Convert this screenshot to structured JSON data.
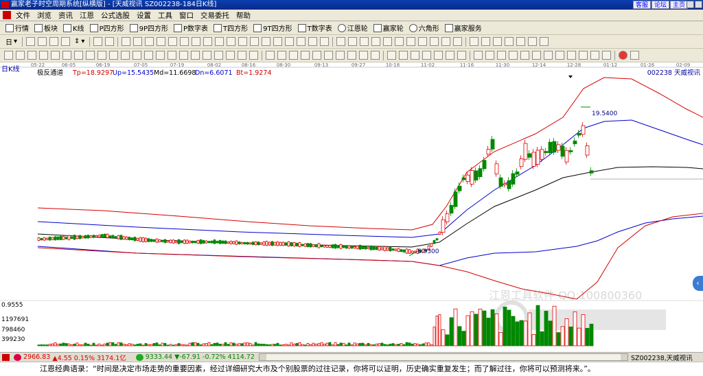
{
  "window": {
    "title": "赢家老子时空周期系统[纵横版] - [天威视讯  SZ002238-184日K线]",
    "links": [
      "客服",
      "论坛",
      "主页"
    ]
  },
  "menu": [
    "文件",
    "浏览",
    "资讯",
    "江恩",
    "公式选股",
    "设置",
    "工具",
    "窗口",
    "交易委托",
    "帮助"
  ],
  "toolbar1": [
    {
      "label": "行情",
      "icon": "quote-icon"
    },
    {
      "label": "板块",
      "icon": "sector-icon"
    },
    {
      "label": "K线",
      "icon": "kline-icon"
    },
    {
      "label": "P四方形",
      "icon": "p-square-icon"
    },
    {
      "label": "9P四方形",
      "icon": "9p-square-icon"
    },
    {
      "label": "P数字表",
      "icon": "p-table-icon"
    },
    {
      "label": "T四方形",
      "icon": "t-square-icon"
    },
    {
      "label": "9T四方形",
      "icon": "9t-square-icon"
    },
    {
      "label": "T数字表",
      "icon": "t-table-icon"
    },
    {
      "label": "江恩轮",
      "icon": "gann-wheel-icon"
    },
    {
      "label": "赢家轮",
      "icon": "winner-wheel-icon"
    },
    {
      "label": "六角形",
      "icon": "hexagon-icon"
    },
    {
      "label": "赢家服务",
      "icon": "service-icon"
    }
  ],
  "toolbar2": {
    "period": "日",
    "arrow": "⇕"
  },
  "chart": {
    "period_label": "日K线",
    "indicator": "极反通道",
    "tp": "Tp=18.9297",
    "up": "Up=15.5435",
    "md": "Md=11.6698",
    "dn": "Dn=6.6071",
    "bt": "Bt=1.9274",
    "code_name": "002238  天威视讯",
    "dates": [
      "05-22",
      "06-05",
      "06-19",
      "07-05",
      "07-19",
      "08-02",
      "08-16",
      "08-30",
      "09-13",
      "09-27",
      "10-18",
      "11-02",
      "11-16",
      "11-30",
      "12-14",
      "12-28",
      "01-12",
      "01-26",
      "02-09"
    ],
    "high_label": "19.5400",
    "low_label": "6.9300",
    "vol_labels": [
      "0.9555",
      "1197691",
      "798460",
      "399230"
    ],
    "watermark": "江恩工具软件  QQ:100800360",
    "colors": {
      "up": "#e00000",
      "down": "#008800",
      "upper": "#d40000",
      "mid": "#000000",
      "lower": "#0000cc",
      "axis": "#0000a0"
    }
  },
  "chart_data": {
    "type": "candlestick",
    "xlabel": "",
    "ylabel": "",
    "high": 19.54,
    "low": 6.93,
    "channel": {
      "tp": 18.9297,
      "up": 15.5435,
      "md": 11.6698,
      "dn": 6.6071,
      "bt": 1.9274
    }
  },
  "status": {
    "index1": "2966.83",
    "chg1": "▲4.55 0.15% 3174.1亿",
    "index2": "9333.44",
    "chg2": "▼-67.91 -0.72% 4114.72",
    "code": "SZ002238,天威视讯"
  },
  "quote": "江恩经典语录：“时间是决定市场走势的重要因素，经过详细研究大市及个别股票的过往记录，你将可以证明，历史确实重复发生；而了解过往，你将可以预测将来。”。"
}
